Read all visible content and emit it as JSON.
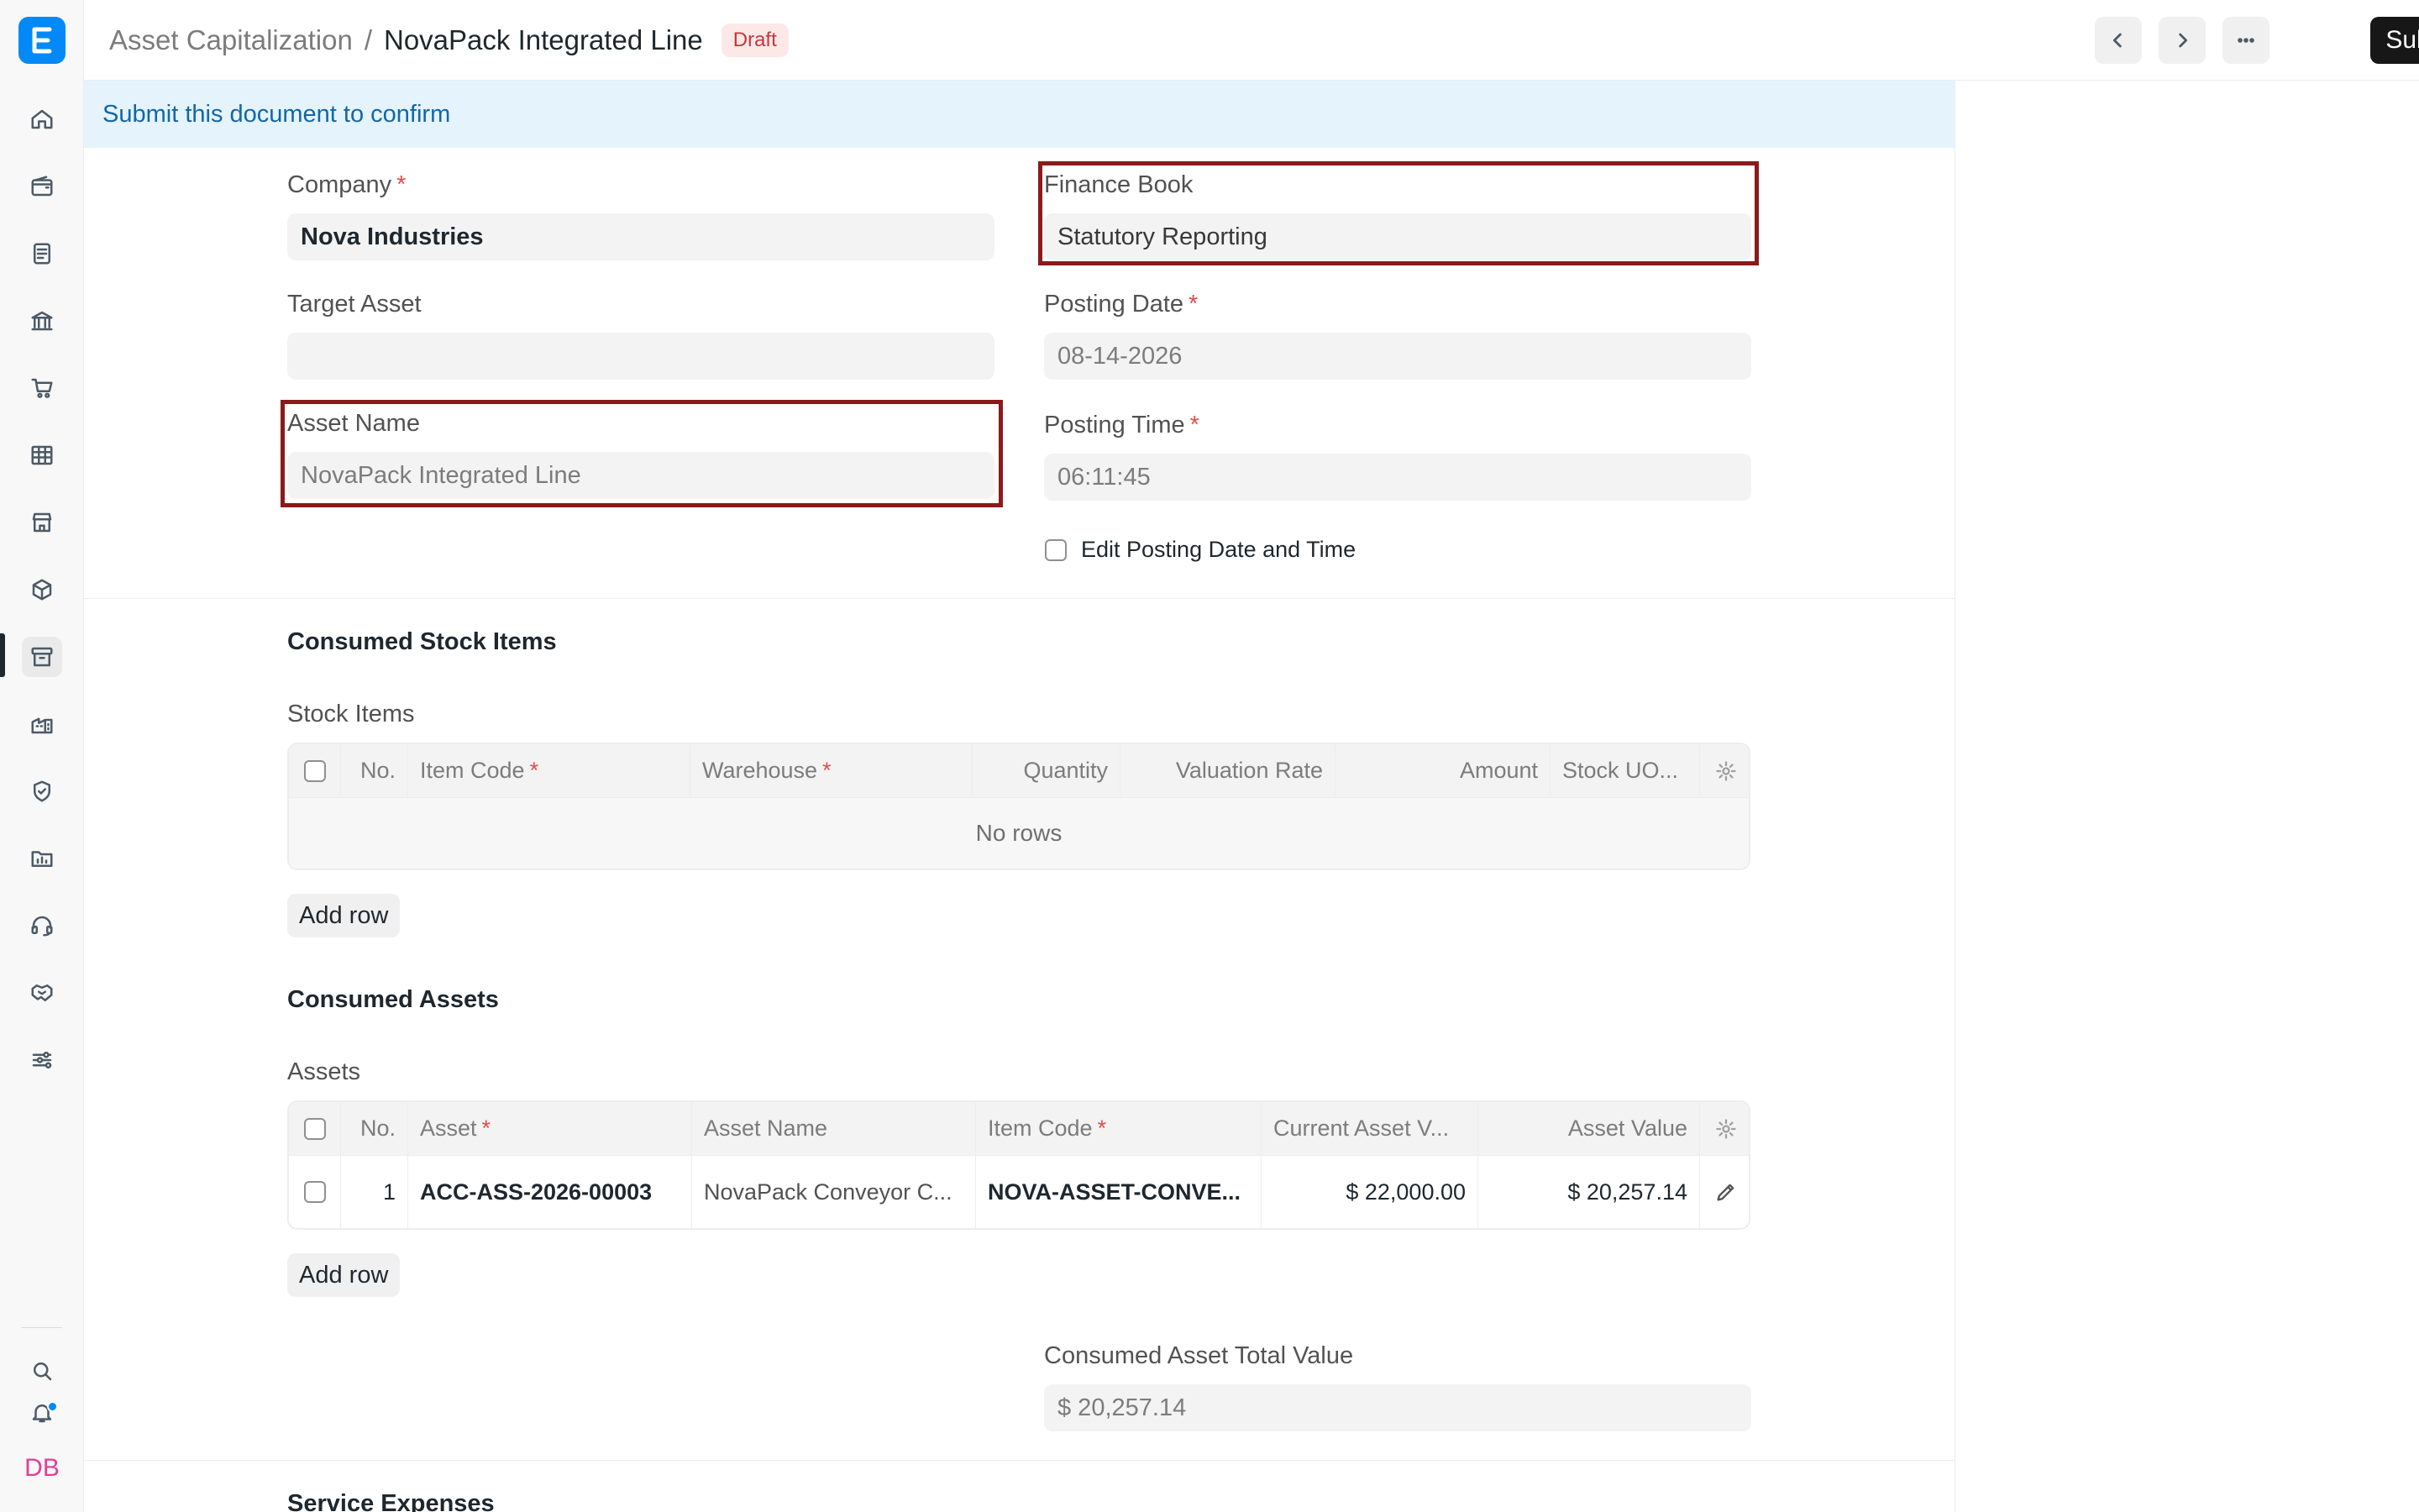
{
  "app": {
    "logo_letter": "E",
    "avatar_initials": "DB"
  },
  "sidebar": {
    "items": [
      {
        "icon": "home-icon"
      },
      {
        "icon": "wallet-icon"
      },
      {
        "icon": "document-icon"
      },
      {
        "icon": "bank-icon"
      },
      {
        "icon": "cart-icon"
      },
      {
        "icon": "table-icon"
      },
      {
        "icon": "store-icon"
      },
      {
        "icon": "box-icon"
      },
      {
        "icon": "archive-icon",
        "active": true
      },
      {
        "icon": "building-icon"
      },
      {
        "icon": "shield-icon"
      },
      {
        "icon": "folder-chart-icon"
      },
      {
        "icon": "headset-icon"
      },
      {
        "icon": "handshake-icon"
      },
      {
        "icon": "sliders-icon"
      }
    ],
    "bottom": [
      {
        "icon": "search-icon"
      },
      {
        "icon": "bell-icon"
      }
    ]
  },
  "header": {
    "breadcrumb_parent": "Asset Capitalization",
    "separator": "/",
    "title": "NovaPack Integrated Line",
    "status": "Draft",
    "submit_label": "Submit"
  },
  "banner": {
    "text": "Submit this document to confirm"
  },
  "form": {
    "company": {
      "label": "Company",
      "value": "Nova Industries",
      "required": true
    },
    "finance_book": {
      "label": "Finance Book",
      "value": "Statutory Reporting"
    },
    "target_asset": {
      "label": "Target Asset",
      "value": ""
    },
    "posting_date": {
      "label": "Posting Date",
      "value": "08-14-2026",
      "required": true
    },
    "asset_name": {
      "label": "Asset Name",
      "value": "NovaPack Integrated Line"
    },
    "posting_time": {
      "label": "Posting Time",
      "value": "06:11:45",
      "required": true
    },
    "edit_posting": {
      "label": "Edit Posting Date and Time",
      "checked": false
    }
  },
  "consumed_stock": {
    "section_title": "Consumed Stock Items",
    "table_label": "Stock Items",
    "columns": [
      "No.",
      "Item Code",
      "Warehouse",
      "Quantity",
      "Valuation Rate",
      "Amount",
      "Stock UO..."
    ],
    "empty_text": "No rows",
    "add_row": "Add row"
  },
  "consumed_assets": {
    "section_title": "Consumed Assets",
    "table_label": "Assets",
    "columns": [
      "No.",
      "Asset",
      "Asset Name",
      "Item Code",
      "Current Asset V...",
      "Asset Value"
    ],
    "rows": [
      {
        "no": "1",
        "asset": "ACC-ASS-2026-00003",
        "asset_name": "NovaPack Conveyor C...",
        "item_code": "NOVA-ASSET-CONVE...",
        "current_value": "$ 22,000.00",
        "asset_value": "$ 20,257.14"
      }
    ],
    "add_row": "Add row",
    "total_label": "Consumed Asset Total Value",
    "total_value": "$ 20,257.14"
  },
  "next_section": {
    "title": "Service Expenses"
  },
  "required_mark": "*"
}
